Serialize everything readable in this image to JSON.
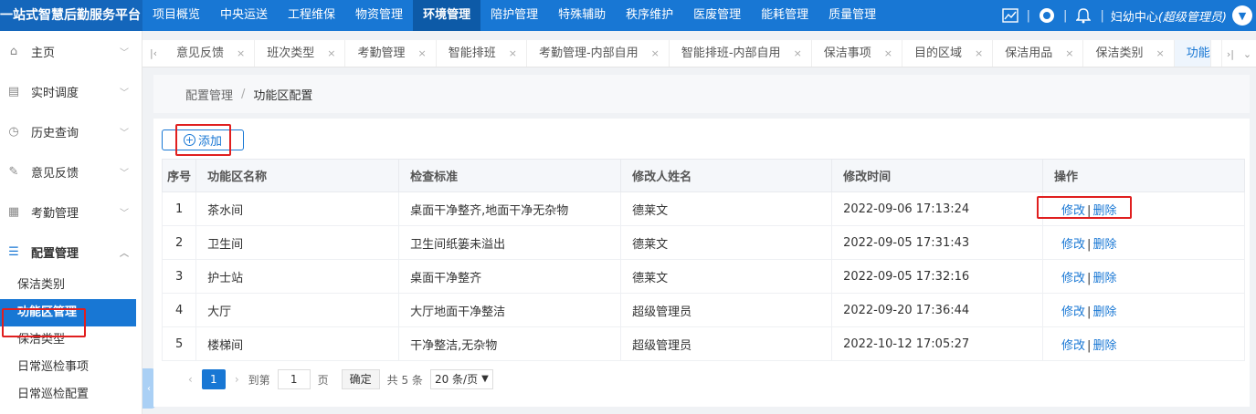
{
  "app": {
    "title": "一站式智慧后勤服务平台"
  },
  "topnav": {
    "items": [
      "项目概览",
      "中央运送",
      "工程维保",
      "物资管理",
      "环境管理",
      "陪护管理",
      "特殊辅助",
      "秩序维护",
      "医废管理",
      "能耗管理",
      "质量管理"
    ],
    "active_index": 4
  },
  "user": {
    "name": "妇幼中心",
    "role": "(超级管理员)"
  },
  "sidebar": {
    "menu": [
      {
        "label": "主页",
        "icon": "home-icon"
      },
      {
        "label": "实时调度",
        "icon": "dispatch-icon"
      },
      {
        "label": "历史查询",
        "icon": "history-icon"
      },
      {
        "label": "意见反馈",
        "icon": "feedback-icon"
      },
      {
        "label": "考勤管理",
        "icon": "attendance-icon"
      },
      {
        "label": "配置管理",
        "icon": "config-icon"
      }
    ],
    "submenu": [
      "保洁类别",
      "功能区管理",
      "保洁类型",
      "日常巡检事项",
      "日常巡检配置"
    ],
    "active_sub_index": 1
  },
  "tabs": {
    "items": [
      "意见反馈",
      "班次类型",
      "考勤管理",
      "智能排班",
      "考勤管理-内部自用",
      "智能排班-内部自用",
      "保洁事项",
      "目的区域",
      "保洁用品",
      "保洁类别"
    ],
    "active": "功能"
  },
  "breadcrumb": {
    "parent": "配置管理",
    "separator": "/",
    "current": "功能区配置"
  },
  "toolbar": {
    "add_label": "添加"
  },
  "table": {
    "columns": [
      "序号",
      "功能区名称",
      "检查标准",
      "修改人姓名",
      "修改时间",
      "操作"
    ],
    "rows": [
      {
        "no": "1",
        "name": "茶水间",
        "standard": "桌面干净整齐,地面干净无杂物",
        "editor": "德莱文",
        "time": "2022-09-06 17:13:24"
      },
      {
        "no": "2",
        "name": "卫生间",
        "standard": "卫生间纸篓未溢出",
        "editor": "德莱文",
        "time": "2022-09-05 17:31:43"
      },
      {
        "no": "3",
        "name": "护士站",
        "standard": "桌面干净整齐",
        "editor": "德莱文",
        "time": "2022-09-05 17:32:16"
      },
      {
        "no": "4",
        "name": "大厅",
        "standard": "大厅地面干净整洁",
        "editor": "超级管理员",
        "time": "2022-09-20 17:36:44"
      },
      {
        "no": "5",
        "name": "楼梯间",
        "standard": "干净整洁,无杂物",
        "editor": "超级管理员",
        "time": "2022-10-12 17:05:27"
      }
    ],
    "edit_label": "修改",
    "delete_label": "删除",
    "op_separator": "|"
  },
  "pagination": {
    "current_page": "1",
    "goto_label": "到第",
    "goto_value": "1",
    "page_unit": "页",
    "confirm_label": "确定",
    "total_text": "共 5 条",
    "page_size": "20 条/页"
  },
  "colors": {
    "primary": "#1877d4",
    "highlight": "#e01f1f"
  }
}
